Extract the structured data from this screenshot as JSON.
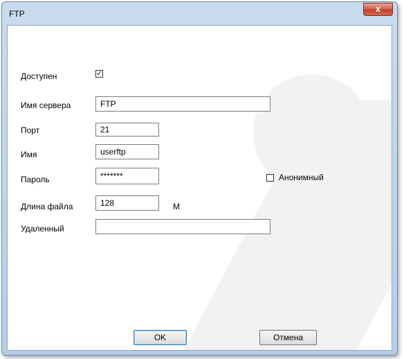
{
  "window": {
    "title": "FTP",
    "close_glyph": "x"
  },
  "form": {
    "enabled_label": "Доступен",
    "enabled_checked": true,
    "server_label": "Имя сервера",
    "server_value": "FTP",
    "port_label": "Порт",
    "port_value": "21",
    "user_label": "Имя",
    "user_value": "userftp",
    "password_label": "Пароль",
    "password_value": "*******",
    "anonymous_label": "Анонимный",
    "anonymous_checked": false,
    "file_length_label": "Длина файла",
    "file_length_value": "128",
    "file_length_unit": "М",
    "remote_label": "Удаленный",
    "remote_value": ""
  },
  "buttons": {
    "ok": "OK",
    "cancel": "Отмена"
  },
  "icons": {
    "close": "close-icon",
    "checkmark": "checkmark-icon"
  }
}
